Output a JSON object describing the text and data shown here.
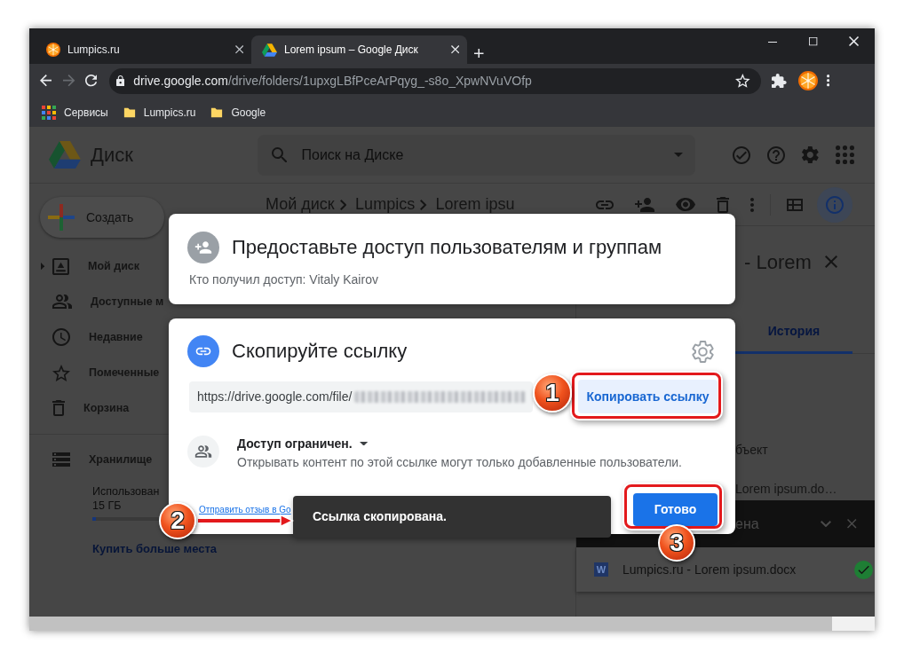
{
  "browser": {
    "tabs": [
      {
        "title": "Lumpics.ru",
        "selected": false
      },
      {
        "title": "Lorem ipsum – Google Диск",
        "selected": true
      }
    ],
    "forward": {
      "disabled": true
    },
    "address": {
      "host": "drive.google.com",
      "path": "/drive/folders/1upxgLBfPceArPqyg_-s8o_XpwNVuVOfp"
    },
    "bookmarks": [
      {
        "kind": "apps",
        "label": "Сервисы"
      },
      {
        "kind": "folder",
        "label": "Lumpics.ru"
      },
      {
        "kind": "folder",
        "label": "Google"
      }
    ]
  },
  "drive": {
    "app_name": "Диск",
    "search": {
      "placeholder": "Поиск на Диске"
    },
    "new_button": "Создать",
    "nav": [
      {
        "kind": "tree",
        "label": "Мой диск"
      },
      {
        "kind": "link",
        "label": "Доступные м"
      },
      {
        "kind": "link",
        "label": "Недавние"
      },
      {
        "kind": "link",
        "label": "Помеченные"
      },
      {
        "kind": "link",
        "label": "Корзина"
      }
    ],
    "storage": {
      "label": "Хранилище",
      "used_label": "Использован",
      "total": "15 ГБ",
      "level": 0.05,
      "buy_link": "Купить больше места"
    },
    "breadcrumb": [
      "Мой диск",
      "Lumpics",
      "Lorem ipsu"
    ],
    "toolbar": {
      "info_active": true
    },
    "details": {
      "title": "- Lorem",
      "tabs": [
        {
          "label": "История",
          "selected": true
        }
      ],
      "entries": [
        "бъект",
        "Lorem ipsum.do…"
      ]
    },
    "uploads": {
      "title": "ена",
      "items": [
        {
          "type_letter": "W",
          "name": "Lumpics.ru - Lorem ipsum.docx",
          "done": true
        }
      ]
    }
  },
  "share_dialog": {
    "title": "Предоставьте доступ пользователям и группам",
    "subtitle": "Кто получил доступ: Vitaly Kairov"
  },
  "link_dialog": {
    "title": "Скопируйте ссылку",
    "link": {
      "value": "https://drive.google.com/file/"
    },
    "copy_button": "Копировать ссылку",
    "access": {
      "label": "Доступ ограничен.",
      "description": "Открывать контент по этой ссылке могут только добавленные пользователи."
    },
    "feedback_link": "Отправить отзыв в Go",
    "done_button": "Готово"
  },
  "toast": {
    "message": "Ссылка скопирована."
  },
  "annotations": [
    {
      "number": "1"
    },
    {
      "number": "2"
    },
    {
      "number": "3"
    }
  ]
}
